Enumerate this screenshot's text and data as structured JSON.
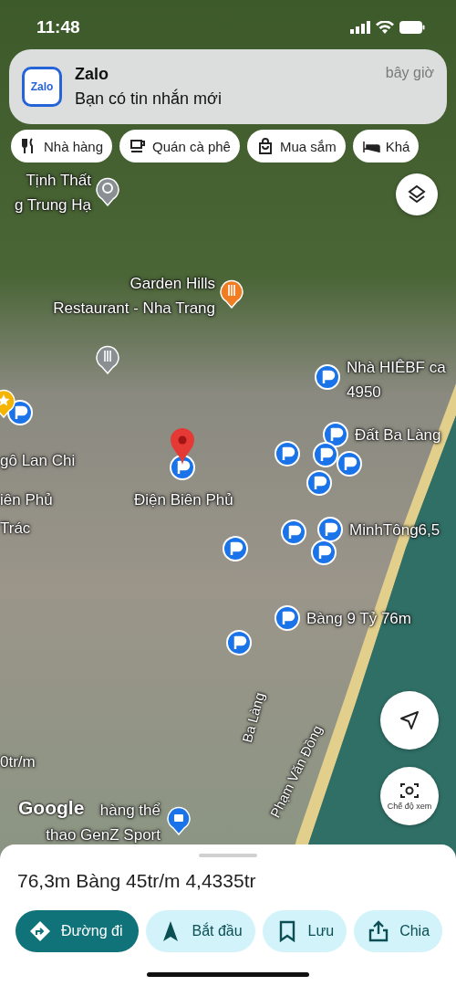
{
  "status_bar": {
    "time": "11:48"
  },
  "notification": {
    "app": "Zalo",
    "icon_text": "Zalo",
    "message": "Bạn có tin nhắn mới",
    "time": "bây giờ"
  },
  "chips": [
    {
      "kind": "restaurant",
      "label": "Nhà hàng"
    },
    {
      "kind": "cafe",
      "label": "Quán cà phê"
    },
    {
      "kind": "shopping",
      "label": "Mua sắm"
    },
    {
      "kind": "hotel",
      "label": "Khá"
    }
  ],
  "map_labels": [
    {
      "kind": "temple",
      "lines": [
        "Tịnh Thất",
        "g Trung Hạ"
      ]
    },
    {
      "kind": "restaurant",
      "lines": [
        "Garden Hills",
        "Restaurant - Nha Trang"
      ]
    },
    {
      "kind": "parking",
      "lines": [
        "Nhà HIÊBF ca",
        "4950"
      ]
    },
    {
      "kind": "parking",
      "lines": [
        "Đất Ba Làng"
      ]
    },
    {
      "kind": "label",
      "lines": [
        "gô Lan Chi"
      ]
    },
    {
      "kind": "label",
      "lines": [
        "Điện Biên Phủ"
      ]
    },
    {
      "kind": "label",
      "lines": [
        "iên Phủ"
      ]
    },
    {
      "kind": "label",
      "lines": [
        "Trác"
      ]
    },
    {
      "kind": "parking",
      "lines": [
        "MinhTông6,5"
      ]
    },
    {
      "kind": "parking",
      "lines": [
        "Bàng 9 Tỷ 76m"
      ]
    },
    {
      "kind": "label",
      "lines": [
        "0tr/m"
      ]
    },
    {
      "kind": "street",
      "lines": [
        "Ba Làng"
      ]
    },
    {
      "kind": "street",
      "lines": [
        "Phạm Văn Đồng"
      ]
    },
    {
      "kind": "shopping",
      "lines": [
        "hàng thể",
        "thao GenZ Sport"
      ]
    }
  ],
  "map_attribution": "Google",
  "view_button": {
    "label": "Chế độ xem"
  },
  "place_sheet": {
    "title": "76,3m Bàng 45tr/m 4,4335tr",
    "actions": [
      {
        "kind": "directions",
        "label": "Đường đi",
        "primary": true
      },
      {
        "kind": "start",
        "label": "Bắt đầu",
        "primary": false
      },
      {
        "kind": "save",
        "label": "Lưu",
        "primary": false
      },
      {
        "kind": "share",
        "label": "Chia",
        "primary": false
      }
    ]
  }
}
